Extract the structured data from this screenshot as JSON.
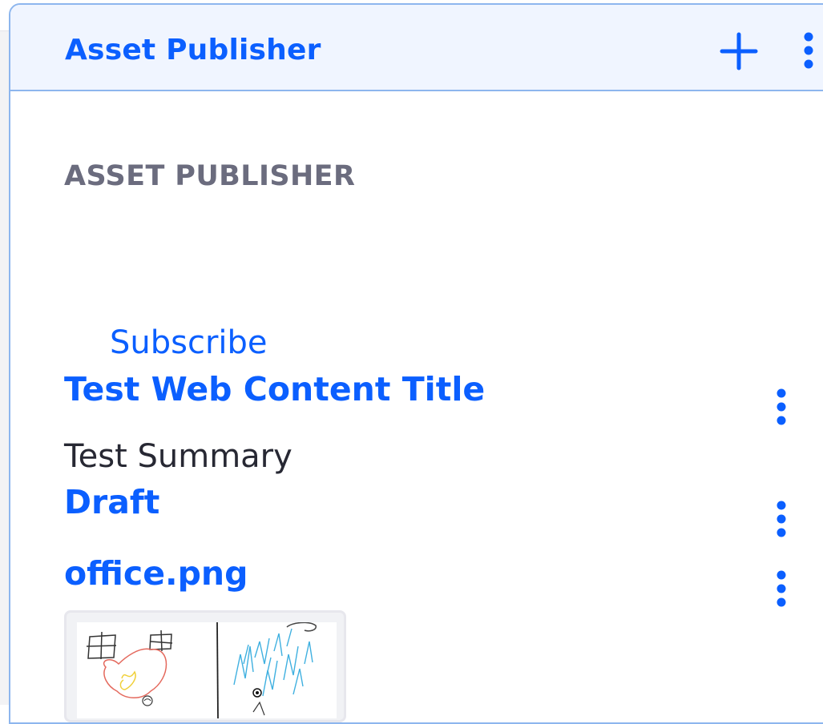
{
  "portlet": {
    "topper_title": "Asset Publisher",
    "add_icon": "plus-icon",
    "options_icon": "kebab-vertical-icon"
  },
  "content": {
    "section_title": "ASSET PUBLISHER",
    "subscribe_label": "Subscribe",
    "assets": [
      {
        "title": "Test Web Content Title",
        "summary": "Test Summary",
        "options_icon": "kebab-vertical-icon"
      },
      {
        "title": "Draft",
        "options_icon": "kebab-vertical-icon"
      },
      {
        "title": "office.png",
        "options_icon": "kebab-vertical-icon",
        "preview": "image-thumbnail"
      }
    ]
  },
  "colors": {
    "primary": "#0b5fff",
    "topper_bg": "#f0f5ff",
    "topper_border": "#8db6ee",
    "secondary_text": "#6b6c7e",
    "body_text": "#272833"
  }
}
